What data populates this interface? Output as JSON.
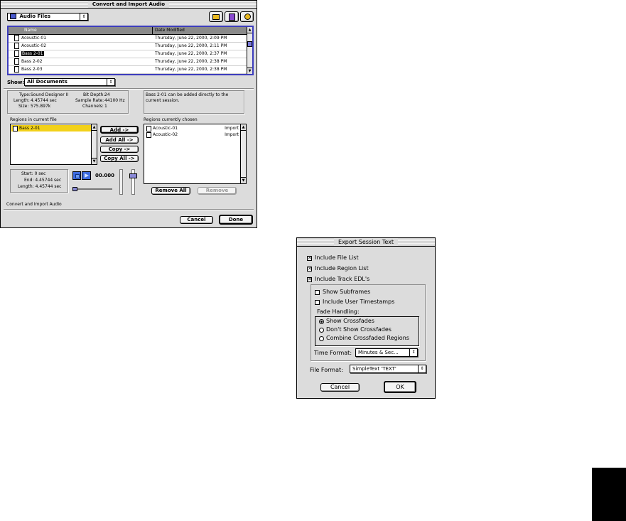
{
  "convert_dialog": {
    "title": "Convert and Import Audio",
    "folder_popup": "Audio Files",
    "file_list": {
      "columns": [
        "Name",
        "Date Modified"
      ],
      "rows": [
        {
          "name": "Acoustic-01",
          "date": "Thursday, June 22, 2000, 2:09 PM",
          "selected": false
        },
        {
          "name": "Acoustic-02",
          "date": "Thursday, June 22, 2000, 2:11 PM",
          "selected": false
        },
        {
          "name": "Bass 2-01",
          "date": "Thursday, June 22, 2000, 2:37 PM",
          "selected": true
        },
        {
          "name": "Bass 2-02",
          "date": "Thursday, June 22, 2000, 2:38 PM",
          "selected": false
        },
        {
          "name": "Bass 2-03",
          "date": "Thursday, June 22, 2000, 2:38 PM",
          "selected": false
        }
      ]
    },
    "show_label": "Show:",
    "show_popup": "All Documents",
    "info": {
      "type_label": "Type:",
      "type_value": "Sound Designer II",
      "length_label": "Length:",
      "length_value": "4.45744 sec",
      "size_label": "Size:",
      "size_value": "575.897k",
      "bitdepth_label": "Bit Depth:",
      "bitdepth_value": "24",
      "samplerate_label": "Sample Rate:",
      "samplerate_value": "44100 Hz",
      "channels_label": "Channels:",
      "channels_value": "1"
    },
    "message": "Bass 2-01 can be added directly to the current session.",
    "regions_current_label": "Regions in current file",
    "regions_current": [
      "Bass 2-01"
    ],
    "regions_chosen_label": "Regions currently chosen",
    "regions_chosen": [
      {
        "name": "Acoustic-01",
        "action": "Import"
      },
      {
        "name": "Acoustic-02",
        "action": "Import"
      }
    ],
    "buttons": {
      "add": "Add ->",
      "add_all": "Add All ->",
      "copy": "Copy ->",
      "copy_all": "Copy All ->",
      "remove_all": "Remove All",
      "remove": "Remove",
      "cancel": "Cancel",
      "done": "Done"
    },
    "playback": {
      "start": "Start: 0 sec",
      "end": "End: 4.45744 sec",
      "length": "Length: 4.45744 sec",
      "time": "00.000"
    },
    "status": "Convert and Import Audio"
  },
  "export_dialog": {
    "title": "Export Session Text",
    "include_edl": {
      "label": "Include File List",
      "checked": true
    },
    "include_region": {
      "label": "Include Region List",
      "checked": true
    },
    "include_track": {
      "label": "Include Track EDL's",
      "checked": true
    },
    "show_subframes": {
      "label": "Show Subframes",
      "checked": false
    },
    "include_user_ts": {
      "label": "Include User Timestamps",
      "checked": false
    },
    "fade_handling_label": "Fade Handling:",
    "fade_options": [
      {
        "label": "Show Crossfades",
        "selected": true
      },
      {
        "label": "Don't Show Crossfades",
        "selected": false
      },
      {
        "label": "Combine Crossfaded Regions",
        "selected": false
      }
    ],
    "time_format_label": "Time Format:",
    "time_format_value": "Minutes & Sec...",
    "file_format_label": "File Format:",
    "file_format_value": "SimpleText 'TEXT'",
    "cancel": "Cancel",
    "ok": "OK"
  }
}
